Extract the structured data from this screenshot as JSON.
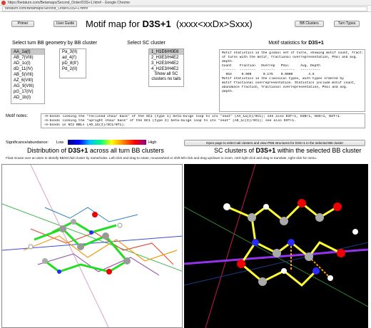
{
  "browser": {
    "window_title": "https://betaturn.com/Betamaps/Second_Order/D3S+1.htm# - Google Chrome",
    "address": "betaturn.com/Betamaps/Second_Order/D3S+1.htm#"
  },
  "toolbar": {
    "primer_label": "Primer",
    "user_guide_label": "User Guide",
    "bb_clusters_label": "BB Clusters",
    "turn_types_label": "Turn Types"
  },
  "header": {
    "title_prefix": "Motif map for ",
    "title_motif": "D3S+1",
    "title_pattern": "(xxxx<xxDx>Sxxx)"
  },
  "bb_cluster": {
    "label": "Select turn BB geometry by BB cluster",
    "items_col1": [
      "AA_1a(I)",
      "AB_7(VIII)",
      "AD_1c(I)",
      "dD_11(IV)",
      "AB_5(VIII)",
      "AZ_6(VIII)",
      "AG_9(VIII)",
      "pG_17(IV)",
      "AD_1b(I)"
    ],
    "items_col2": [
      "Pa_3(II)",
      "ad_4(I')",
      "pD_8(II')",
      "Pd_2(II)"
    ],
    "selected": "AA_1a(I)"
  },
  "sc_cluster": {
    "label": "Select SC cluster",
    "items": [
      "1_H1E6/H0E6",
      "2_H3E3/H4E2",
      "3_H2E3/H4E2",
      "4_H2E3/H4E2"
    ],
    "show_all": "Show all SC clusters no tails",
    "selected": "1_H1E6/H0E6"
  },
  "stats": {
    "label_prefix": "Motif statistics for ",
    "label_motif": "D3S+1",
    "lines": [
      "Motif statistics in the global set of turns, showing motif count, fraction",
      "of turns with the motif, fractional overrepresentation, PVal and avg.",
      "depth.",
      "",
      "Count    Fraction   Overrep   PVal      Avg. Depth",
      "-------  --------   -------   -------   ----------",
      "  953     0.009      0.175    0.0000        4.6",
      "",
      "Motif statistics in the classical types, with types ordered by",
      "motif fractional overrepresentation. Statistics include motif count,",
      "abundance fraction, fractional overrepresentation, PVal and avg.",
      "depth."
    ]
  },
  "notes": {
    "label": "Motif notes:",
    "lines": [
      "-H-bonds linking the \"reclined chair back\" of the SC1 (type 1) beta-bulge loop to its \"seat\" (AA_1a(I)/SC1); see also D3T+1, D3N+1, N3S+1, N3T+1.",
      "-H-bonds linking the \"upright chair back\" of the 6C1 (type 2) beta-bulge loop to its \"seat\" (AD_1c(I)/SC1); see also D3T+1.",
      "-H-bonds in 6C2 BBLs (AD_1b(I)/SC1/NT1)."
    ]
  },
  "legend": {
    "label": "Significance/abundance:",
    "low": "Low",
    "high": "High"
  },
  "open_page_label": "Open page to select tail clusters and view PDB structures for D3S+1 in the selected BB cluster",
  "left_panel": {
    "title_prefix": "Distribution of ",
    "title_motif": "D3S+1",
    "title_suffix": " across all turn BB clusters",
    "subtitle": "Float mouse over an atom to identify BB/SC/tail cluster by name/index. Left-click and drag to rotate, mousewheel or shift-left-click and drag up/down to zoom, cntrl-right-click and drag to translate, right-click for menu."
  },
  "right_panel": {
    "title_prefix": "SC clusters of ",
    "title_motif": "D3S+1",
    "title_suffix": " within the selected BB cluster"
  },
  "colors": {
    "selected_item": "#c8c8c8",
    "viewer_bg": "#000000"
  }
}
